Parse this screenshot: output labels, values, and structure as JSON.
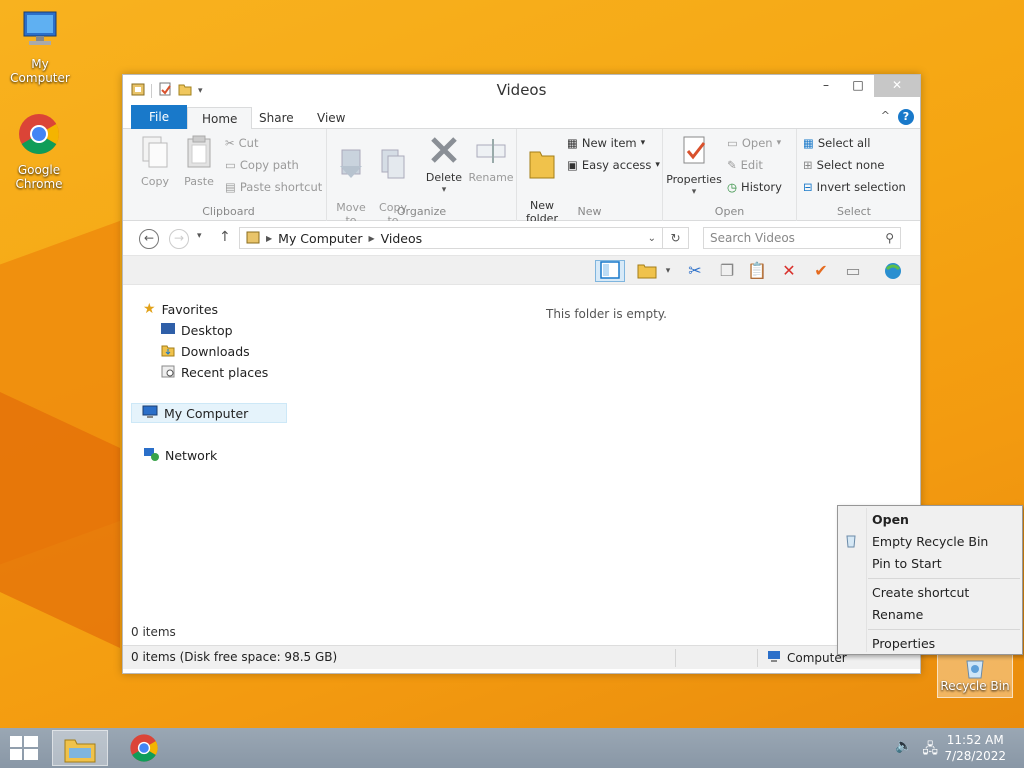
{
  "desktop": {
    "icons": [
      {
        "label": "My Computer"
      },
      {
        "label": "Google Chrome"
      },
      {
        "label": "Recycle Bin"
      }
    ]
  },
  "window": {
    "title": "Videos",
    "controls": {
      "minimize": "–",
      "maximize": "□",
      "close": "✕"
    },
    "tabs": {
      "file": "File",
      "home": "Home",
      "share": "Share",
      "view": "View"
    },
    "help": "?",
    "ribbon": {
      "clipboard": {
        "label": "Clipboard",
        "copy": "Copy",
        "paste": "Paste",
        "cut": "Cut",
        "copy_path": "Copy path",
        "paste_shortcut": "Paste shortcut"
      },
      "organize": {
        "label": "Organize",
        "move_to": "Move\nto",
        "copy_to": "Copy\nto",
        "delete": "Delete",
        "rename": "Rename"
      },
      "new": {
        "label": "New",
        "new_folder": "New\nfolder",
        "new_item": "New item",
        "easy_access": "Easy access"
      },
      "open": {
        "label": "Open",
        "properties": "Properties",
        "open": "Open",
        "edit": "Edit",
        "history": "History"
      },
      "select": {
        "label": "Select",
        "select_all": "Select all",
        "select_none": "Select none",
        "invert": "Invert selection"
      }
    },
    "address": {
      "segments": [
        "My Computer",
        "Videos"
      ]
    },
    "search": {
      "placeholder": "Search Videos"
    },
    "nav": {
      "favorites": "Favorites",
      "desktop": "Desktop",
      "downloads": "Downloads",
      "recent": "Recent places",
      "my_computer": "My Computer",
      "network": "Network"
    },
    "content": {
      "empty_message": "This folder is empty."
    },
    "item_count": "0 items",
    "status": {
      "left": "0 items (Disk free space: 98.5 GB)",
      "right": "Computer"
    }
  },
  "context_menu": {
    "items": [
      "Open",
      "Empty Recycle Bin",
      "Pin to Start",
      "Create shortcut",
      "Rename",
      "Properties"
    ]
  },
  "taskbar": {
    "time": "11:52 AM",
    "date": "7/28/2022"
  },
  "colors": {
    "accent": "#1979ca",
    "wallpaper": "#f5a512",
    "taskbar": "#8f9caa"
  }
}
